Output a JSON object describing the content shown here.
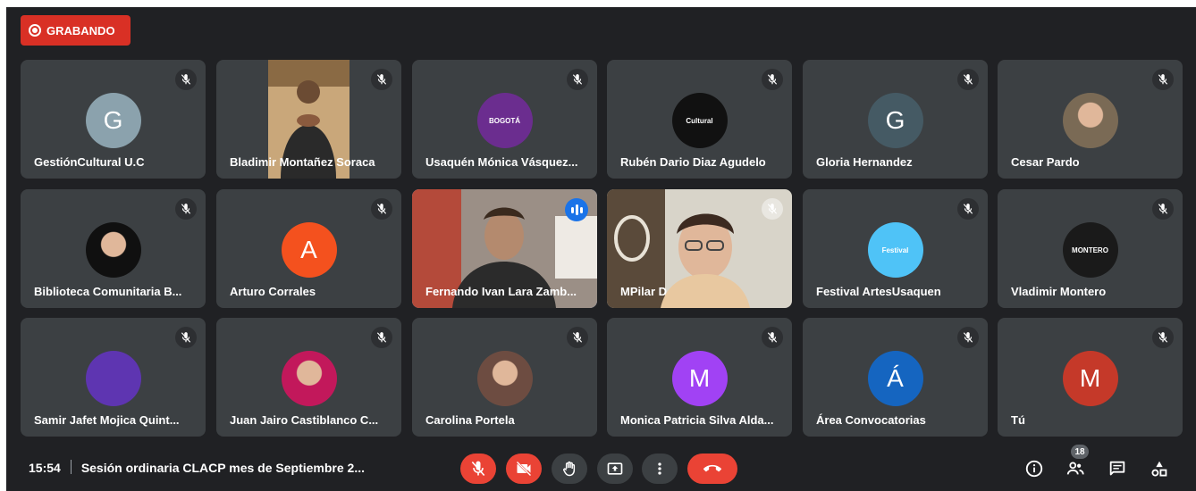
{
  "recording": {
    "label": "GRABANDO"
  },
  "tiles": [
    {
      "name": "GestiónCultural U.C",
      "initial": "G",
      "avatar_color": "#8ba2ad",
      "avatar_type": "letter",
      "muted": true
    },
    {
      "name": "Bladimir Montañez Soraca",
      "avatar_type": "video",
      "video_desc": "sign-language-interpreter",
      "muted": true
    },
    {
      "name": "Usaquén Mónica Vásquez...",
      "avatar_type": "logo",
      "logo_label": "BOGOTÁ",
      "avatar_color": "#6b2d8f",
      "muted": true
    },
    {
      "name": "Rubén Dario Diaz Agudelo",
      "avatar_type": "logo",
      "logo_label": "Cultural",
      "avatar_color": "#111111",
      "muted": true
    },
    {
      "name": "Gloria Hernandez",
      "initial": "G",
      "avatar_color": "#455a64",
      "avatar_type": "letter",
      "muted": true
    },
    {
      "name": "Cesar Pardo",
      "avatar_type": "photo",
      "avatar_color": "#7a6a55",
      "muted": true
    },
    {
      "name": "Biblioteca Comunitaria B...",
      "avatar_type": "photo",
      "avatar_color": "#101010",
      "muted": true
    },
    {
      "name": "Arturo Corrales",
      "initial": "A",
      "avatar_color": "#f4511e",
      "avatar_type": "letter",
      "muted": true
    },
    {
      "name": "Fernando Ivan Lara Zamb...",
      "avatar_type": "video",
      "video_desc": "man-speaking",
      "speaking": true
    },
    {
      "name": "MPilar D",
      "avatar_type": "video",
      "video_desc": "woman-with-glasses",
      "muted": true
    },
    {
      "name": "Festival ArtesUsaquen",
      "avatar_type": "logo",
      "logo_label": "Festival",
      "avatar_color": "#4fc3f7",
      "muted": true
    },
    {
      "name": "Vladimir Montero",
      "avatar_type": "logo",
      "logo_label": "MONTERO",
      "avatar_color": "#1a1a1a",
      "muted": true
    },
    {
      "name": "Samir Jafet Mojica Quint...",
      "avatar_type": "logo",
      "avatar_color": "#5e35b1",
      "muted": true
    },
    {
      "name": "Juan Jairo Castiblanco C...",
      "avatar_type": "photo",
      "avatar_color": "#c2185b",
      "muted": true
    },
    {
      "name": "Carolina Portela",
      "avatar_type": "photo",
      "avatar_color": "#6d4c41",
      "muted": true
    },
    {
      "name": "Monica Patricia Silva Alda...",
      "initial": "M",
      "avatar_color": "#a142f4",
      "avatar_type": "letter",
      "muted": true
    },
    {
      "name": "Área Convocatorias",
      "initial": "Á",
      "avatar_color": "#1565c0",
      "avatar_type": "letter",
      "muted": true
    },
    {
      "name": "Tú",
      "initial": "M",
      "avatar_color": "#c53929",
      "avatar_type": "letter",
      "muted": true
    }
  ],
  "bottom": {
    "time": "15:54",
    "meeting_title": "Sesión ordinaria CLACP mes de Septiembre 2...",
    "controls": [
      "mic-off-icon",
      "camera-off-icon",
      "raise-hand-icon",
      "present-icon",
      "more-icon",
      "end-call-icon"
    ],
    "participant_count": "18",
    "right_icons": [
      "info-icon",
      "people-icon",
      "chat-icon",
      "activities-icon"
    ]
  },
  "colors": {
    "background": "#202124",
    "tile": "#3c4043",
    "red": "#ea4335",
    "accent": "#1a73e8"
  }
}
